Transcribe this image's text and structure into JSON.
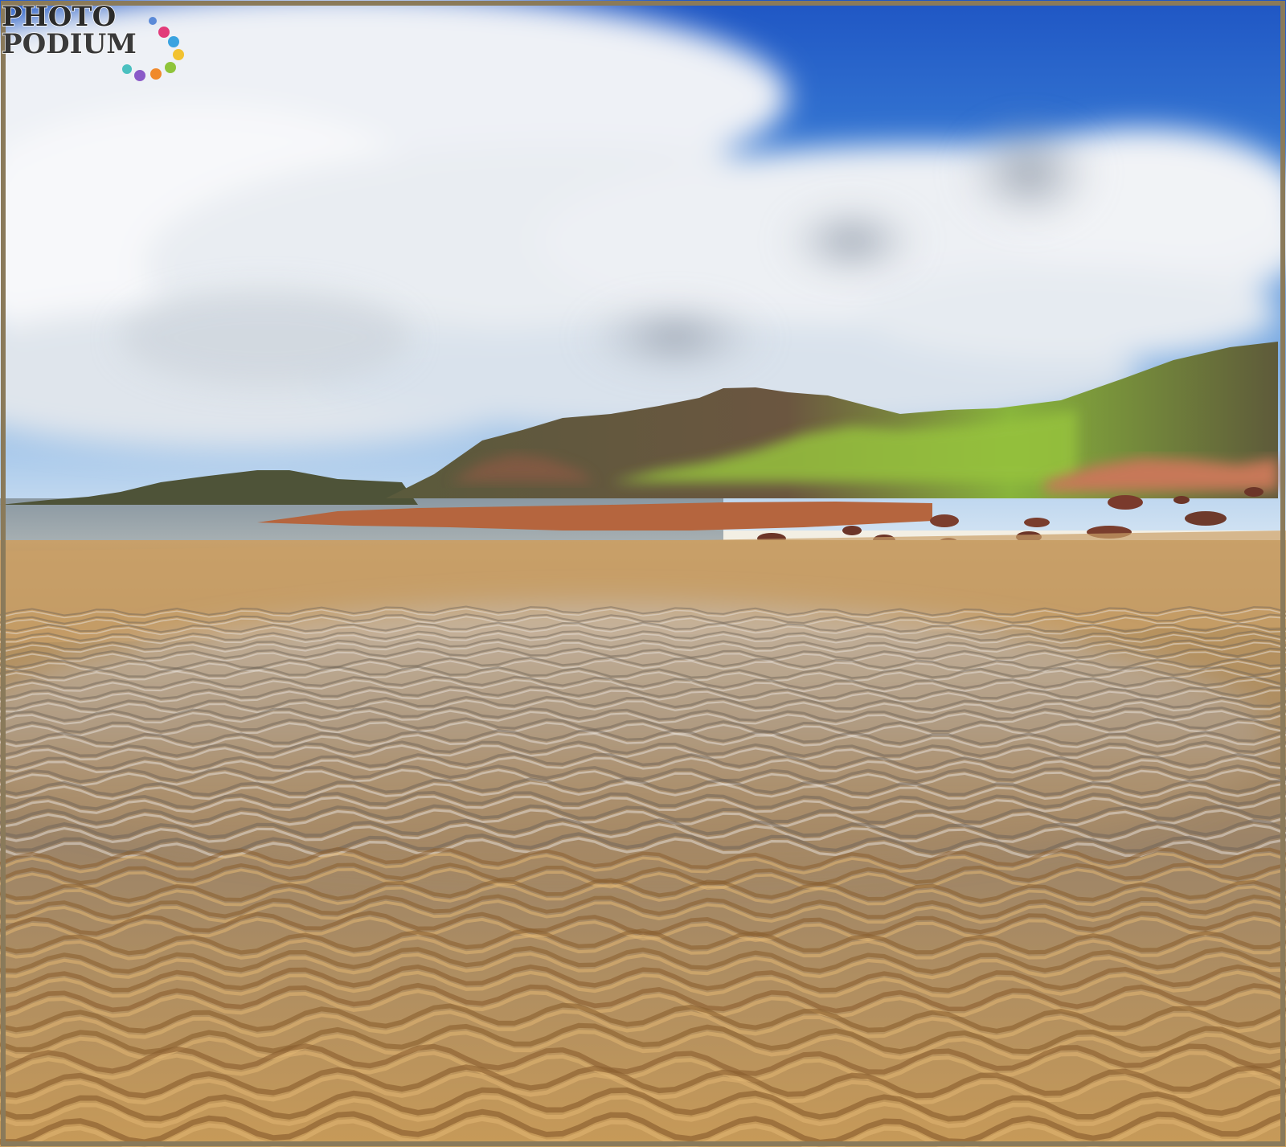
{
  "photo": {
    "subject": "beach-landscape",
    "elements": [
      "sky",
      "clouds",
      "hills",
      "boulders",
      "sea",
      "wet-sand-ripples"
    ]
  },
  "watermark": {
    "line1": "PHOTO",
    "line2": "PODIUM",
    "icon": "photopodium-logo"
  },
  "colors": {
    "sky_blue": "#2f6bd0",
    "cloud_white": "#f2f4f7",
    "hill_green": "#8fbf3a",
    "rock_red": "#b4654a",
    "sand": "#c49a5e",
    "frame_border": "#8a7a5a"
  }
}
